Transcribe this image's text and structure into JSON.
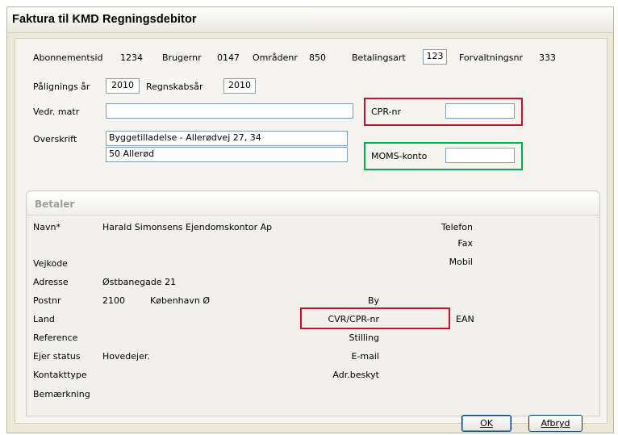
{
  "window": {
    "title": "Faktura til KMD Regningsdebitor"
  },
  "header_row1": {
    "abonnementsid_label": "Abonnementsid",
    "abonnementsid_value": "1234",
    "brugernr_label": "Brugernr",
    "brugernr_value": "0147",
    "omraadenr_label": "Områdenr",
    "omraadenr_value": "850",
    "betalingsart_label": "Betalingsart",
    "betalingsart_value": "123",
    "forvaltningsnr_label": "Forvaltningsnr",
    "forvaltningsnr_value": "333"
  },
  "header_row2": {
    "paaligningsaar_label": "Pålignings år",
    "paaligningsaar_value": "2010",
    "regnskabsaar_label": "Regnskabsår",
    "regnskabsaar_value": "2010"
  },
  "fields": {
    "vedr_matr_label": "Vedr. matr",
    "vedr_matr_value": "",
    "cpr_label": "CPR-nr",
    "cpr_value": "",
    "overskrift_label": "Overskrift",
    "overskrift_line1": "Byggetilladelse - Allerødvej 27, 34",
    "overskrift_line2": "50  Allerød",
    "moms_label": "MOMS-konto",
    "moms_value": ""
  },
  "betaler": {
    "title": "Betaler",
    "navn_label": "Navn*",
    "navn_value": "Harald Simonsens Ejendomskontor Ap",
    "telefon_label": "Telefon",
    "fax_label": "Fax",
    "mobil_label": "Mobil",
    "vejkode_label": "Vejkode",
    "adresse_label": "Adresse",
    "adresse_value": "Østbanegade 21",
    "postnr_label": "Postnr",
    "postnr_value": "2100",
    "postnr_city": "København Ø",
    "by_label": "By",
    "land_label": "Land",
    "cvr_label": "CVR/CPR-nr",
    "ean_label": "EAN",
    "reference_label": "Reference",
    "stilling_label": "Stilling",
    "ejer_status_label": "Ejer status",
    "ejer_status_value": "Hovedejer.",
    "email_label": "E-mail",
    "kontakttype_label": "Kontakttype",
    "adr_beskyt_label": "Adr.beskyt",
    "bemaerkning_label": "Bemærkning"
  },
  "buttons": {
    "ok": "OK",
    "afbryd": "Afbryd"
  },
  "colors": {
    "highlight_red": "#c8102e",
    "highlight_green": "#00b050"
  }
}
